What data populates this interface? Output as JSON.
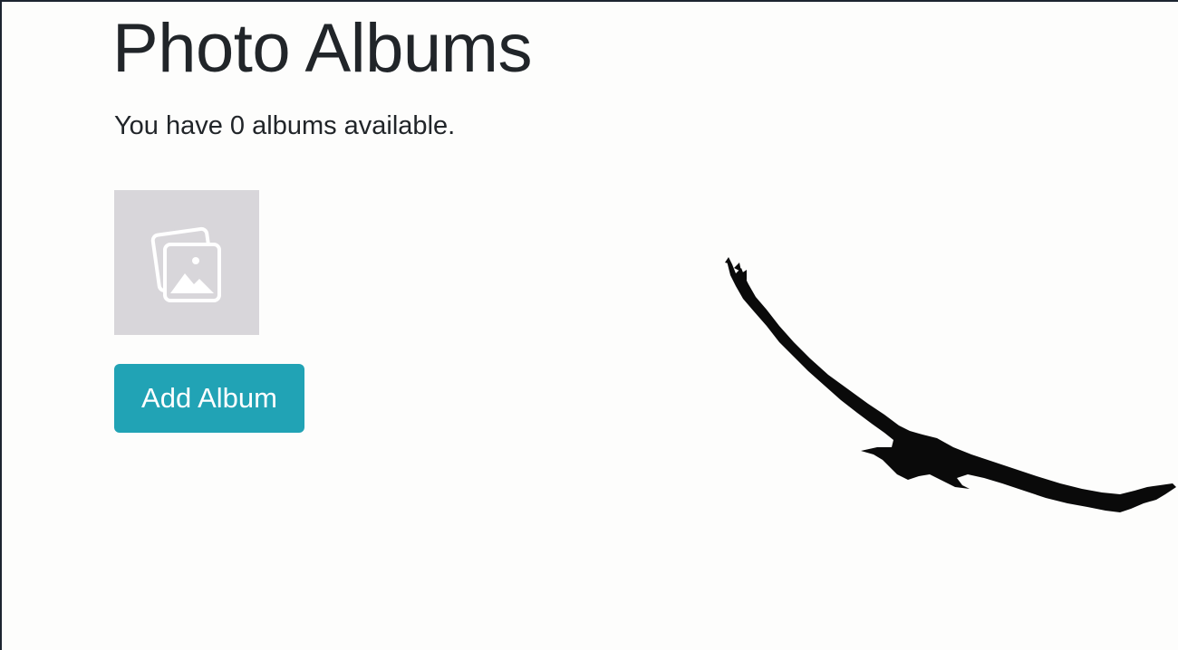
{
  "page": {
    "title": "Photo Albums",
    "subtitle": "You have 0 albums available."
  },
  "album_placeholder": {
    "icon": "image-placeholder-icon"
  },
  "actions": {
    "add_album_label": "Add Album"
  },
  "background": {
    "image": "bird-silhouette"
  },
  "colors": {
    "background": "#fdfdfc",
    "text": "#212529",
    "button_bg": "#21a3b5",
    "button_text": "#ffffff",
    "placeholder_bg": "#d8d6da",
    "placeholder_icon": "#ffffff"
  }
}
